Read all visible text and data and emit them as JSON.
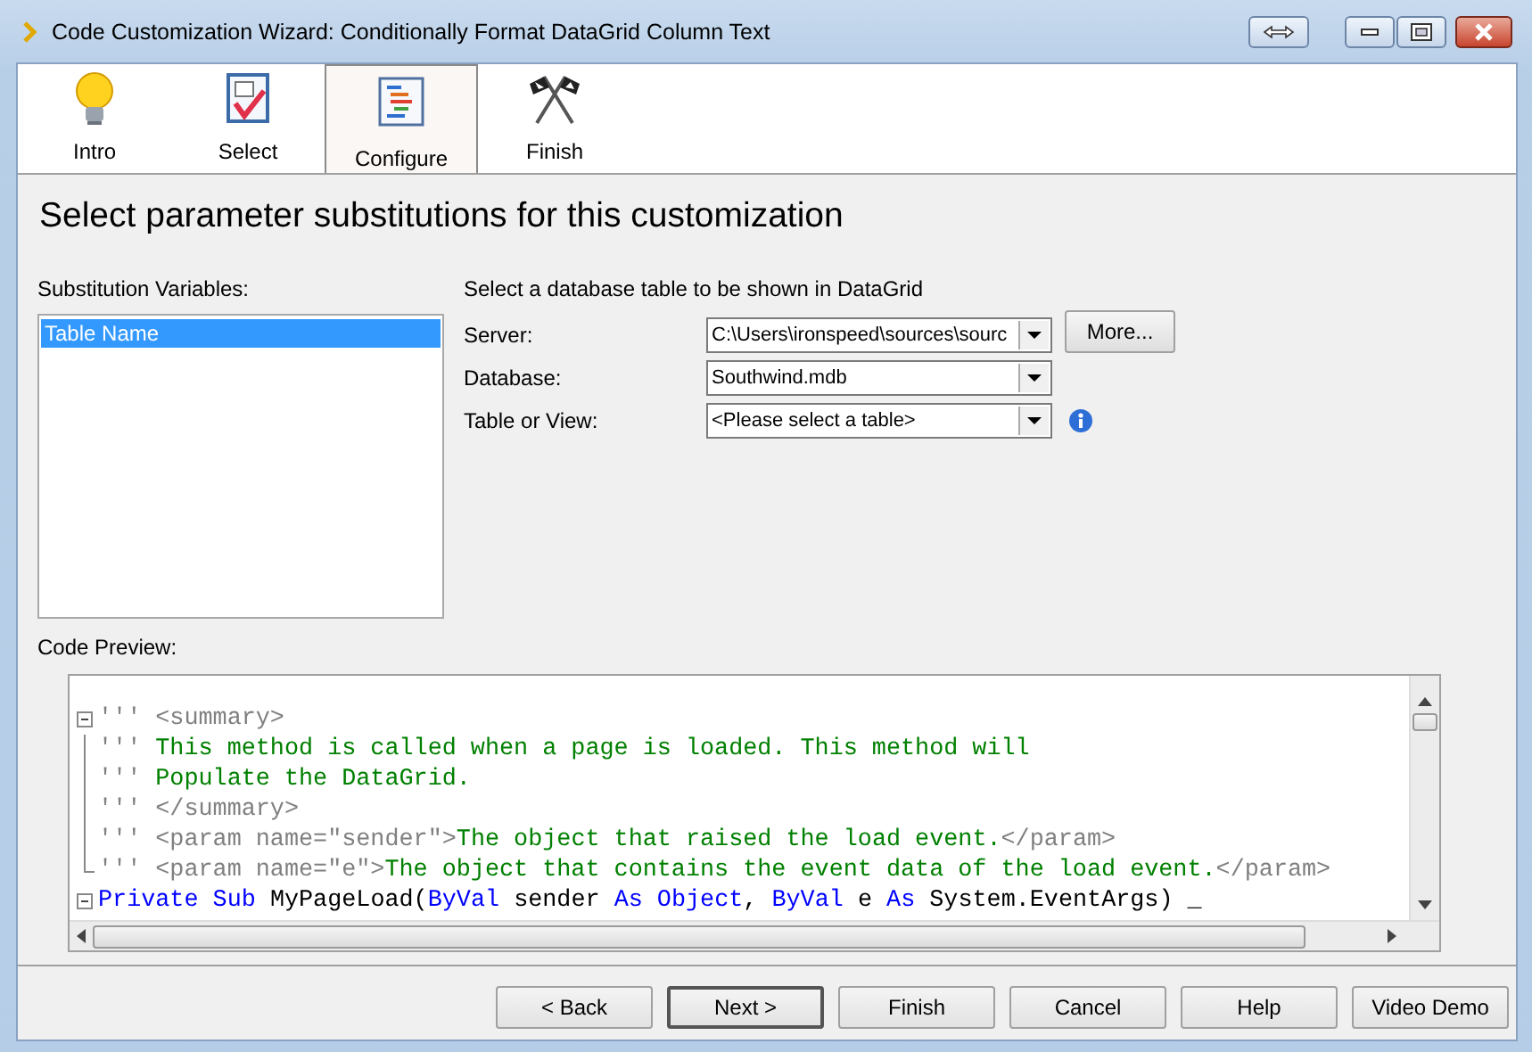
{
  "window": {
    "title": "Code Customization Wizard: Conditionally Format DataGrid Column Text"
  },
  "steps": [
    {
      "label": "Intro",
      "kind": "bulb",
      "selected": false
    },
    {
      "label": "Select",
      "kind": "checklist",
      "selected": false
    },
    {
      "label": "Configure",
      "kind": "outline",
      "selected": true
    },
    {
      "label": "Finish",
      "kind": "flags",
      "selected": false
    }
  ],
  "heading": "Select parameter substitutions for this customization",
  "variables": {
    "label": "Substitution Variables:",
    "items": [
      {
        "label": "Table Name",
        "selected": true
      }
    ]
  },
  "database": {
    "caption": "Select a database table to be shown in DataGrid",
    "fields": [
      {
        "label": "Server:",
        "value": "C:\\Users\\ironspeed\\sources\\sourc",
        "button": "More..."
      },
      {
        "label": "Database:",
        "value": "Southwind.mdb"
      },
      {
        "label": "Table or View:",
        "value": "<Please select a table>",
        "info": true
      }
    ]
  },
  "code_preview": {
    "label": "Code Preview:",
    "lines": [
      {
        "kind": "fold-start",
        "tokens": [
          {
            "kind": "marker",
            "text": "'''"
          },
          {
            "kind": "tag",
            "text": " <summary>"
          }
        ]
      },
      {
        "kind": "fold-body",
        "tokens": [
          {
            "kind": "marker",
            "text": "'''"
          },
          {
            "kind": "comment",
            "text": " This method is called when a page is loaded. This method will"
          }
        ]
      },
      {
        "kind": "fold-body",
        "tokens": [
          {
            "kind": "marker",
            "text": "'''"
          },
          {
            "kind": "comment",
            "text": " Populate the DataGrid."
          }
        ]
      },
      {
        "kind": "fold-body",
        "tokens": [
          {
            "kind": "marker",
            "text": "'''"
          },
          {
            "kind": "tag",
            "text": " </summary>"
          }
        ]
      },
      {
        "kind": "fold-body",
        "tokens": [
          {
            "kind": "marker",
            "text": "'''"
          },
          {
            "kind": "tag",
            "text": " <param name=\"sender\">"
          },
          {
            "kind": "comment",
            "text": "The object that raised the load event."
          },
          {
            "kind": "tag",
            "text": "</param>"
          }
        ]
      },
      {
        "kind": "fold-end",
        "tokens": [
          {
            "kind": "marker",
            "text": "'''"
          },
          {
            "kind": "tag",
            "text": " <param name=\"e\">"
          },
          {
            "kind": "comment",
            "text": "The object that contains the event data of the load event."
          },
          {
            "kind": "tag",
            "text": "</param>"
          }
        ]
      },
      {
        "kind": "fold-start",
        "tokens": [
          {
            "kind": "keyword",
            "text": "Private Sub"
          },
          {
            "kind": "plain",
            "text": " MyPageLoad("
          },
          {
            "kind": "keyword",
            "text": "ByVal"
          },
          {
            "kind": "plain",
            "text": " sender "
          },
          {
            "kind": "keyword",
            "text": "As Object"
          },
          {
            "kind": "plain",
            "text": ", "
          },
          {
            "kind": "keyword",
            "text": "ByVal"
          },
          {
            "kind": "plain",
            "text": " e "
          },
          {
            "kind": "keyword",
            "text": "As"
          },
          {
            "kind": "plain",
            "text": " System.EventArgs) _"
          }
        ]
      }
    ]
  },
  "buttons": [
    {
      "label": "< Back",
      "default": false
    },
    {
      "label": "Next >",
      "default": true
    },
    {
      "label": "Finish",
      "default": false
    },
    {
      "label": "Cancel",
      "default": false
    },
    {
      "label": "Help",
      "default": false
    },
    {
      "label": "Video Demo",
      "default": false
    }
  ]
}
